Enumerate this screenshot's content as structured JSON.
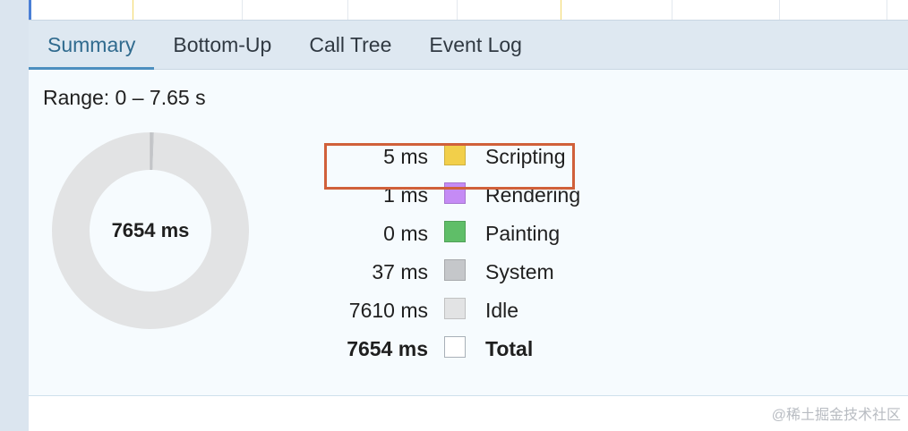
{
  "tabs": [
    {
      "label": "Summary",
      "active": true
    },
    {
      "label": "Bottom-Up",
      "active": false
    },
    {
      "label": "Call Tree",
      "active": false
    },
    {
      "label": "Event Log",
      "active": false
    }
  ],
  "summary": {
    "range": "Range: 0 – 7.65 s",
    "total_label": "7654 ms",
    "legend": [
      {
        "value": "5 ms",
        "label": "Scripting",
        "color": "#f2cf4a"
      },
      {
        "value": "1 ms",
        "label": "Rendering",
        "color": "#c58bf5"
      },
      {
        "value": "0 ms",
        "label": "Painting",
        "color": "#5fbe68"
      },
      {
        "value": "37 ms",
        "label": "System",
        "color": "#c5c7ca"
      },
      {
        "value": "7610 ms",
        "label": "Idle",
        "color": "#e2e3e4"
      },
      {
        "value": "7654 ms",
        "label": "Total",
        "color": "#ffffff"
      }
    ]
  },
  "chart_data": {
    "type": "pie",
    "categories": [
      "Scripting",
      "Rendering",
      "Painting",
      "System",
      "Idle"
    ],
    "values": [
      5,
      1,
      0,
      37,
      7610
    ],
    "title": "",
    "center_label": "7654 ms"
  },
  "colors": {
    "highlight": "#d0603a",
    "active_tab": "#2f6a8e",
    "tab_bar": "#dee8f1"
  },
  "watermark": "@稀土掘金技术社区"
}
